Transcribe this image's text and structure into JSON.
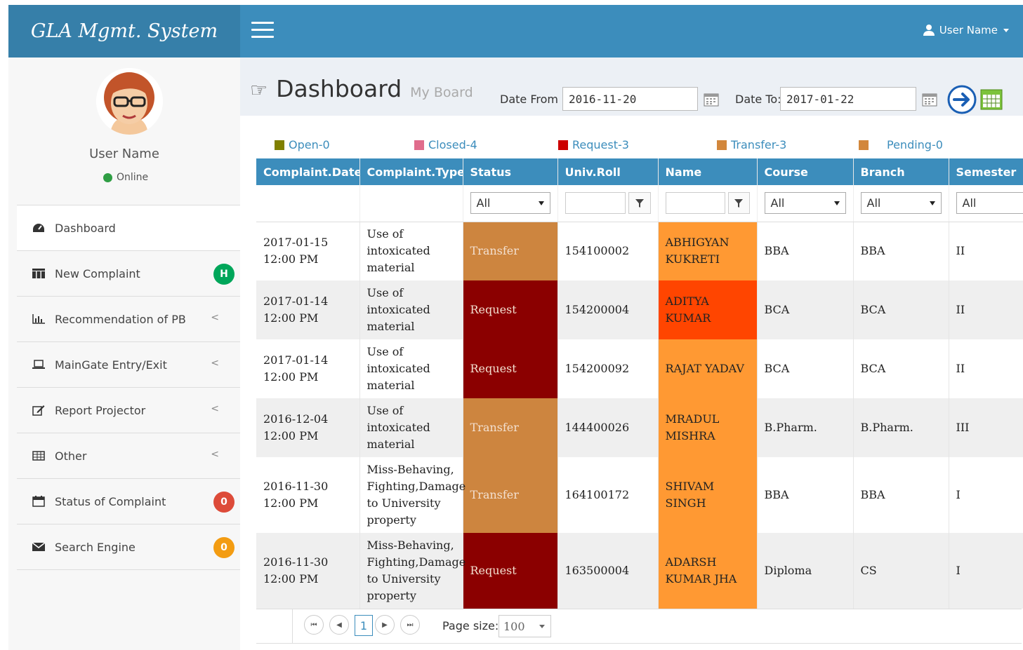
{
  "app": {
    "title": "GLA Mgmt. System",
    "user_menu": "User Name"
  },
  "profile": {
    "name": "User Name",
    "status": "Online"
  },
  "sidebar": {
    "items": [
      {
        "label": "Dashboard",
        "icon": "dashboard-icon"
      },
      {
        "label": "New Complaint",
        "icon": "grid-icon",
        "badge": "H",
        "badge_color": "#00a65a"
      },
      {
        "label": "Recommendation of PB",
        "icon": "bar-chart-icon",
        "chevron": "<"
      },
      {
        "label": "MainGate Entry/Exit",
        "icon": "laptop-icon",
        "chevron": "<"
      },
      {
        "label": "Report Projector",
        "icon": "edit-icon",
        "chevron": "<"
      },
      {
        "label": "Other",
        "icon": "table-icon",
        "chevron": "<"
      },
      {
        "label": "Status of Complaint",
        "icon": "calendar-icon",
        "badge": "0",
        "badge_color": "#dd4b39"
      },
      {
        "label": "Search Engine",
        "icon": "envelope-icon",
        "badge": "0",
        "badge_color": "#f39c12"
      }
    ]
  },
  "page": {
    "title": "Dashboard",
    "subtitle": "My Board"
  },
  "dates": {
    "from_label": "Date From :",
    "from_value": "2016-11-20",
    "to_label": "Date To:",
    "to_value": "2017-01-22"
  },
  "legend": [
    {
      "label": "Open-0",
      "color": "#808000"
    },
    {
      "label": "Closed-4",
      "color": "#e06c8c"
    },
    {
      "label": "Request-3",
      "color": "#cc0000"
    },
    {
      "label": "Transfer-3",
      "color": "#d2873c"
    },
    {
      "label": "Pending-0",
      "color": "#d2873c"
    }
  ],
  "grid": {
    "columns": [
      "Complaint.Date",
      "Complaint.Type",
      "Status",
      "Univ.Roll",
      "Name",
      "Course",
      "Branch",
      "Semester"
    ],
    "filters": {
      "status": "All",
      "course": "All",
      "branch": "All",
      "semester": "All"
    },
    "status_colors": {
      "Transfer": "#cd853f",
      "Request": "#8b0000"
    },
    "rows": [
      {
        "date": "2017-01-15",
        "time": "12:00 PM",
        "type": [
          "Use of",
          "intoxicated",
          "material"
        ],
        "status": "Transfer",
        "roll": "154100002",
        "name": [
          "ABHIGYAN",
          "KUKRETI"
        ],
        "name_color": "#ff9933",
        "course": "BBA",
        "branch": "BBA",
        "semester": "II"
      },
      {
        "date": "2017-01-14",
        "time": "12:00 PM",
        "type": [
          "Use of",
          "intoxicated",
          "material"
        ],
        "status": "Request",
        "roll": "154200004",
        "name": [
          "ADITYA KUMAR"
        ],
        "name_color": "#ff4500",
        "course": "BCA",
        "branch": "BCA",
        "semester": "II"
      },
      {
        "date": "2017-01-14",
        "time": "12:00 PM",
        "type": [
          "Use of",
          "intoxicated",
          "material"
        ],
        "status": "Request",
        "roll": "154200092",
        "name": [
          "RAJAT YADAV"
        ],
        "name_color": "#ff9933",
        "course": "BCA",
        "branch": "BCA",
        "semester": "II"
      },
      {
        "date": "2016-12-04",
        "time": "12:00 PM",
        "type": [
          "Use of",
          "intoxicated",
          "material"
        ],
        "status": "Transfer",
        "roll": "144400026",
        "name": [
          "MRADUL",
          "MISHRA"
        ],
        "name_color": "#ff9933",
        "course": "B.Pharm.",
        "branch": "B.Pharm.",
        "semester": "III"
      },
      {
        "date": "2016-11-30",
        "time": "12:00 PM",
        "type": [
          "Miss-Behaving,",
          "Fighting,Damage",
          "to University",
          "property"
        ],
        "status": "Transfer",
        "roll": "164100172",
        "name": [
          "SHIVAM SINGH"
        ],
        "name_color": "#ff9933",
        "course": "BBA",
        "branch": "BBA",
        "semester": "I"
      },
      {
        "date": "2016-11-30",
        "time": "12:00 PM",
        "type": [
          "Miss-Behaving,",
          "Fighting,Damage",
          "to University",
          "property"
        ],
        "status": "Request",
        "roll": "163500004",
        "name": [
          "ADARSH",
          "KUMAR JHA"
        ],
        "name_color": "#ff9933",
        "course": "Diploma",
        "branch": "CS",
        "semester": "I"
      }
    ]
  },
  "pager": {
    "current_page": "1",
    "page_size_label": "Page size:",
    "page_size": "100"
  }
}
